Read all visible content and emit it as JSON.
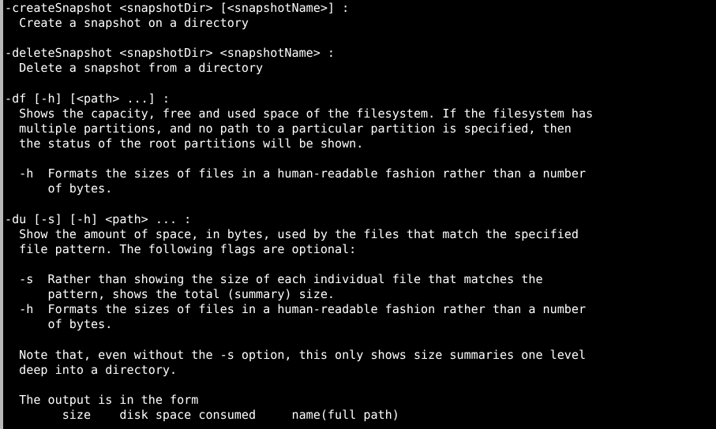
{
  "terminal": {
    "background_color": "#000000",
    "text_color": "#ffffff",
    "left_border_color": "#b9b9b9",
    "font_family": "monospace",
    "columns": 83,
    "rows": 28,
    "lines": [
      "-createSnapshot <snapshotDir> [<snapshotName>] :",
      "  Create a snapshot on a directory",
      "",
      "-deleteSnapshot <snapshotDir> <snapshotName> :",
      "  Delete a snapshot from a directory",
      "",
      "-df [-h] [<path> ...] :",
      "  Shows the capacity, free and used space of the filesystem. If the filesystem has",
      "  multiple partitions, and no path to a particular partition is specified, then",
      "  the status of the root partitions will be shown.",
      "",
      "  -h  Formats the sizes of files in a human-readable fashion rather than a number",
      "      of bytes.",
      "",
      "-du [-s] [-h] <path> ... :",
      "  Show the amount of space, in bytes, used by the files that match the specified",
      "  file pattern. The following flags are optional:",
      "",
      "  -s  Rather than showing the size of each individual file that matches the",
      "      pattern, shows the total (summary) size.",
      "  -h  Formats the sizes of files in a human-readable fashion rather than a number",
      "      of bytes.",
      "",
      "  Note that, even without the -s option, this only shows size summaries one level",
      "  deep into a directory.",
      "",
      "  The output is in the form",
      "        size    disk space consumed     name(full path)"
    ]
  }
}
